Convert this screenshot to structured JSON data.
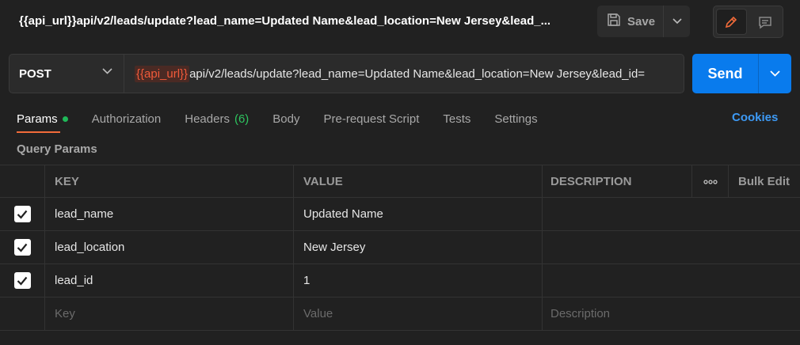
{
  "request": {
    "title": "{{api_url}}api/v2/leads/update?lead_name=Updated Name&lead_location=New Jersey&lead_...",
    "method": "POST",
    "url_variable": "{{api_url}}",
    "url_rest": "api/v2/leads/update?lead_name=Updated Name&lead_location=New Jersey&lead_id="
  },
  "toolbar": {
    "save_label": "Save",
    "send_label": "Send"
  },
  "tabs": [
    {
      "label": "Params",
      "active": true,
      "indicator": "green-dot"
    },
    {
      "label": "Authorization"
    },
    {
      "label": "Headers",
      "count": "(6)"
    },
    {
      "label": "Body"
    },
    {
      "label": "Pre-request Script"
    },
    {
      "label": "Tests"
    },
    {
      "label": "Settings"
    }
  ],
  "cookies_label": "Cookies",
  "query_params": {
    "title": "Query Params",
    "columns": {
      "key": "KEY",
      "value": "VALUE",
      "description": "DESCRIPTION",
      "bulk_edit": "Bulk Edit"
    },
    "rows": [
      {
        "checked": true,
        "key": "lead_name",
        "value": "Updated Name",
        "description": ""
      },
      {
        "checked": true,
        "key": "lead_location",
        "value": "New Jersey",
        "description": ""
      },
      {
        "checked": true,
        "key": "lead_id",
        "value": "1",
        "description": ""
      }
    ],
    "placeholders": {
      "key": "Key",
      "value": "Value",
      "description": "Description"
    }
  },
  "colors": {
    "accent": "#097bed",
    "link": "#3d9af5",
    "variable": "#f05a3a",
    "active_tab": "#f26b3a"
  },
  "icons": [
    "save-icon",
    "chevron-down-icon",
    "pencil-icon",
    "comment-icon",
    "more-horizontal-icon",
    "checkmark-icon"
  ]
}
